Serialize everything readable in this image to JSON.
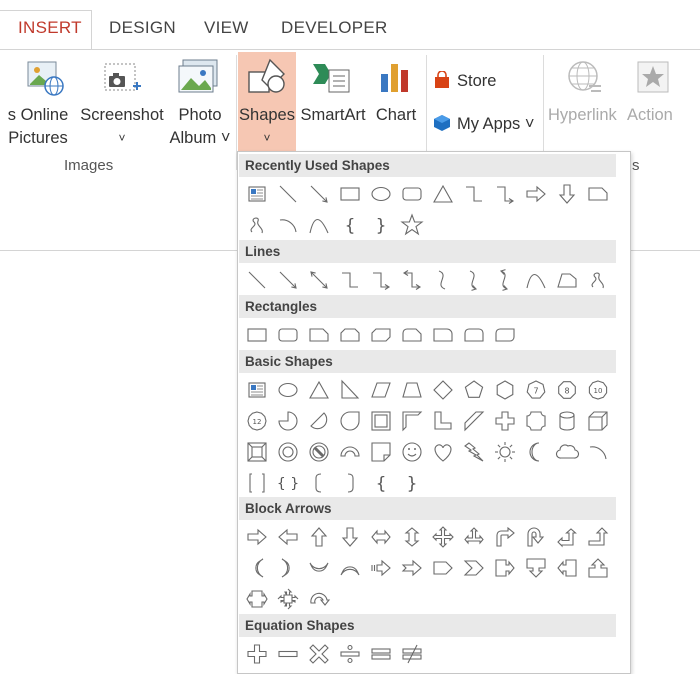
{
  "tabs": [
    {
      "label": "INSERT",
      "active": true
    },
    {
      "label": "DESIGN",
      "active": false
    },
    {
      "label": "VIEW",
      "active": false
    },
    {
      "label": "DEVELOPER",
      "active": false
    }
  ],
  "ribbon": {
    "online_pictures": [
      "s Online",
      "Pictures"
    ],
    "screenshot": [
      "Screenshot",
      "˅"
    ],
    "photo_album": [
      "Photo",
      "Album ˅"
    ],
    "shapes": [
      "Shapes",
      "˅"
    ],
    "smartart": "SmartArt",
    "chart": "Chart",
    "store": "Store",
    "my_apps": "My Apps ˅",
    "hyperlink": "Hyperlink",
    "action": "Action",
    "images_group": "Images",
    "right_fragment": "s"
  },
  "colors": {
    "accent": "#c0392b",
    "shapes_highlight": "#f6c7b3",
    "section_bg": "#e9e9e9"
  },
  "panel": {
    "sections": [
      {
        "title": "Recently Used Shapes",
        "rows": [
          [
            "text-box",
            "line",
            "arrow-line",
            "rectangle",
            "oval",
            "rounded-rectangle",
            "triangle",
            "elbow-connector",
            "elbow-arrow-connector",
            "right-arrow",
            "down-arrow",
            "snip-rectangle"
          ],
          [
            "freeform-scribble",
            "arc",
            "curve",
            "left-brace",
            "right-brace",
            "star-5"
          ]
        ]
      },
      {
        "title": "Lines",
        "rows": [
          [
            "line",
            "arrow-line",
            "double-arrow-line",
            "elbow-connector",
            "elbow-arrow-connector",
            "elbow-double-arrow",
            "curved-connector",
            "curved-arrow-connector",
            "curved-double-arrow",
            "curve",
            "freeform",
            "scribble"
          ]
        ]
      },
      {
        "title": "Rectangles",
        "rows": [
          [
            "rectangle",
            "rounded-rectangle",
            "snip-single-corner",
            "snip-same-side",
            "snip-diagonal",
            "snip-round",
            "round-single-corner",
            "round-same-side",
            "round-diagonal"
          ]
        ]
      },
      {
        "title": "Basic Shapes",
        "rows": [
          [
            "text-box",
            "oval",
            "triangle",
            "right-triangle",
            "parallelogram",
            "trapezoid",
            "diamond",
            "pentagon",
            "hexagon",
            "heptagon-7",
            "octagon-8",
            "decagon-10"
          ],
          [
            "dodecagon-12",
            "pie",
            "chord",
            "teardrop",
            "frame",
            "half-frame",
            "l-shape",
            "diagonal-stripe",
            "cross",
            "plaque",
            "can",
            "cube"
          ],
          [
            "bevel",
            "donut",
            "no-symbol",
            "block-arc",
            "folded-corner",
            "smiley",
            "heart",
            "lightning",
            "sun",
            "moon",
            "cloud",
            "arc"
          ],
          [
            "double-bracket",
            "double-brace",
            "left-bracket",
            "right-bracket",
            "left-brace",
            "right-brace"
          ]
        ]
      },
      {
        "title": "Block Arrows",
        "rows": [
          [
            "right-arrow",
            "left-arrow",
            "up-arrow",
            "down-arrow",
            "left-right-arrow",
            "up-down-arrow",
            "quad-arrow",
            "left-right-up-arrow",
            "bent-arrow",
            "u-turn-arrow",
            "left-up-arrow",
            "bent-up-arrow"
          ],
          [
            "curved-right-arrow",
            "curved-left-arrow",
            "curved-up-arrow",
            "curved-down-arrow",
            "striped-right-arrow",
            "notched-right-arrow",
            "pentagon-arrow",
            "chevron",
            "right-arrow-callout",
            "down-arrow-callout",
            "left-arrow-callout",
            "up-arrow-callout"
          ],
          [
            "left-right-arrow-callout",
            "quad-arrow-callout",
            "circular-arrow"
          ]
        ]
      },
      {
        "title": "Equation Shapes",
        "rows": [
          [
            "plus",
            "minus",
            "multiply",
            "division",
            "equal",
            "not-equal"
          ]
        ]
      }
    ]
  }
}
